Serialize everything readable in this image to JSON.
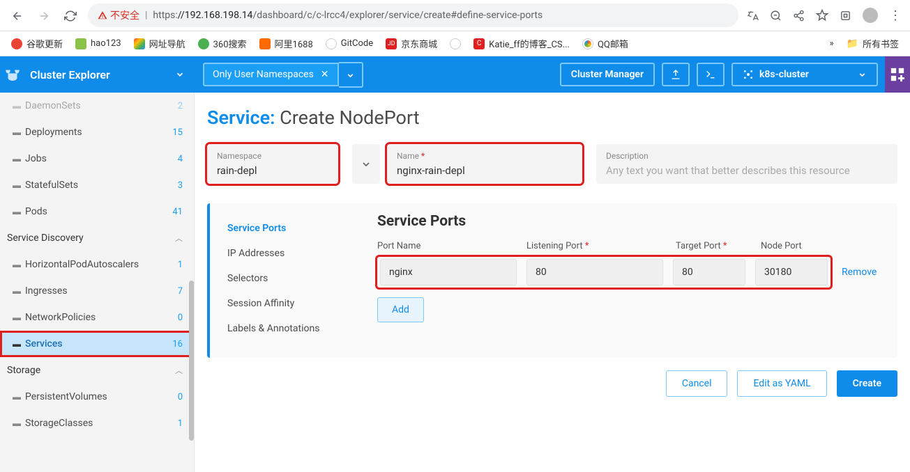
{
  "browser": {
    "insecure_label": "不安全",
    "url_https": "https:",
    "url_host": "//192.168.198.14",
    "url_path": "/dashboard/c/c-lrcc4/explorer/service/create#define-service-ports"
  },
  "bookmarks": {
    "items": [
      {
        "label": "谷歌更新",
        "color": "#ea4335"
      },
      {
        "label": "hao123",
        "color": "#4caf50"
      },
      {
        "label": "网址导航",
        "color": "#3f51b5"
      },
      {
        "label": "360搜索",
        "color": "#4caf50"
      },
      {
        "label": "阿里1688",
        "color": "#ff6a00"
      },
      {
        "label": "GitCode",
        "color": "#666"
      },
      {
        "label": "京东商城",
        "color": "#e02020"
      },
      {
        "label": "",
        "color": "#888"
      },
      {
        "label": "Katie_ff的博客_CS...",
        "color": "#e02020"
      },
      {
        "label": "QQ邮箱",
        "color": "#3eaf3e"
      }
    ],
    "more": "»",
    "all": "所有书签"
  },
  "appbar": {
    "cluster_explorer": "Cluster Explorer",
    "namespace_filter": "Only User Namespaces",
    "cluster_manager": "Cluster Manager",
    "cluster_name": "k8s-cluster"
  },
  "sidebar": {
    "items": [
      {
        "label": "DaemonSets",
        "count": "2",
        "type": "item",
        "faded": true
      },
      {
        "label": "Deployments",
        "count": "15",
        "type": "item"
      },
      {
        "label": "Jobs",
        "count": "4",
        "type": "item"
      },
      {
        "label": "StatefulSets",
        "count": "3",
        "type": "item"
      },
      {
        "label": "Pods",
        "count": "41",
        "type": "item"
      },
      {
        "label": "Service Discovery",
        "type": "header"
      },
      {
        "label": "HorizontalPodAutoscalers",
        "count": "1",
        "type": "item"
      },
      {
        "label": "Ingresses",
        "count": "7",
        "type": "item"
      },
      {
        "label": "NetworkPolicies",
        "count": "0",
        "type": "item"
      },
      {
        "label": "Services",
        "count": "16",
        "type": "item",
        "active": true,
        "redbox": true,
        "darkFolder": true
      },
      {
        "label": "Storage",
        "type": "header"
      },
      {
        "label": "PersistentVolumes",
        "count": "0",
        "type": "item"
      },
      {
        "label": "StorageClasses",
        "count": "1",
        "type": "item"
      }
    ]
  },
  "page": {
    "title_prefix": "Service:",
    "title_main": "Create NodePort",
    "namespace_label": "Namespace",
    "namespace_value": "rain-depl",
    "name_label": "Name",
    "name_value": "nginx-rain-depl",
    "description_label": "Description",
    "description_placeholder": "Any text you want that better describes this resource"
  },
  "sections": {
    "items": [
      {
        "label": "Service Ports",
        "active": true
      },
      {
        "label": "IP Addresses"
      },
      {
        "label": "Selectors"
      },
      {
        "label": "Session Affinity"
      },
      {
        "label": "Labels & Annotations"
      }
    ]
  },
  "ports": {
    "title": "Service Ports",
    "col_port_name": "Port Name",
    "col_listening": "Listening Port",
    "col_target": "Target Port",
    "col_node": "Node Port",
    "row": {
      "name": "nginx",
      "listening": "80",
      "target": "80",
      "node": "30180"
    },
    "remove": "Remove",
    "add": "Add"
  },
  "footer": {
    "cancel": "Cancel",
    "yaml": "Edit as YAML",
    "create": "Create"
  }
}
